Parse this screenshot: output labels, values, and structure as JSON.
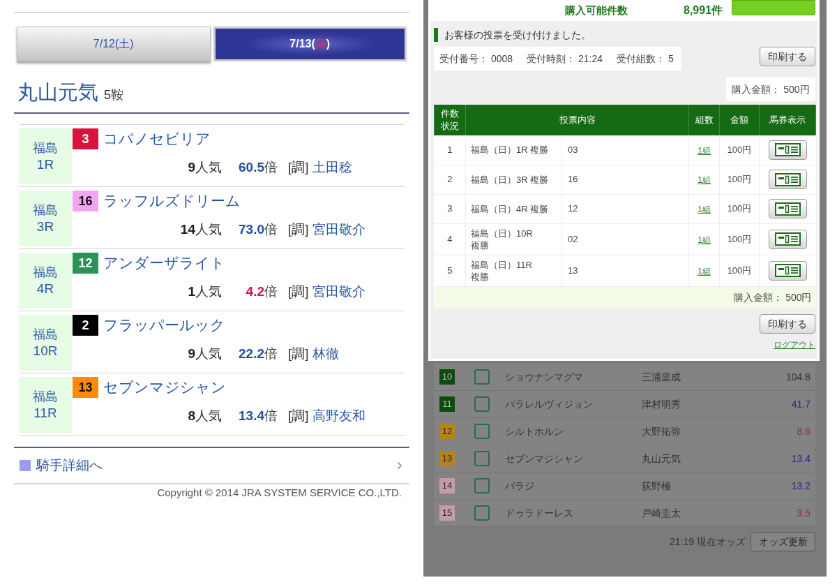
{
  "left_page": {
    "date_tabs": [
      {
        "text_before": "7/12(",
        "weekday": "土",
        "text_after": ")",
        "sunday": false,
        "selected": false
      },
      {
        "text_before": "7/13(",
        "weekday": "日",
        "text_after": ")",
        "sunday": true,
        "selected": true
      }
    ],
    "jockey": {
      "name": "丸山元気",
      "mounts": "5鞍"
    },
    "races": [
      {
        "venue": "福島",
        "race": "1R",
        "horse_number": "3",
        "color": "#d9143c",
        "horse": "コパノセビリア",
        "popularity": "9",
        "popularity_unit": "人気",
        "odds": "60.5",
        "odds_unit": "倍",
        "odds_low": false,
        "trainer_tag": "[調]",
        "trainer": "土田稔"
      },
      {
        "venue": "福島",
        "race": "3R",
        "horse_number": "16",
        "color": "#f3a6f0",
        "horse": "ラッフルズドリーム",
        "popularity": "14",
        "popularity_unit": "人気",
        "odds": "73.0",
        "odds_unit": "倍",
        "odds_low": false,
        "trainer_tag": "[調]",
        "trainer": "宮田敬介"
      },
      {
        "venue": "福島",
        "race": "4R",
        "horse_number": "12",
        "color": "#2e9158",
        "horse": "アンダーザライト",
        "popularity": "1",
        "popularity_unit": "人気",
        "odds": "4.2",
        "odds_unit": "倍",
        "odds_low": true,
        "trainer_tag": "[調]",
        "trainer": "宮田敬介"
      },
      {
        "venue": "福島",
        "race": "10R",
        "horse_number": "2",
        "color": "#000000",
        "horse": "フラッパールック",
        "popularity": "9",
        "popularity_unit": "人気",
        "odds": "22.2",
        "odds_unit": "倍",
        "odds_low": false,
        "trainer_tag": "[調]",
        "trainer": "林徹"
      },
      {
        "venue": "福島",
        "race": "11R",
        "horse_number": "13",
        "color": "#ff8a00",
        "horse": "セブンマジシャン",
        "popularity": "8",
        "popularity_unit": "人気",
        "odds": "13.4",
        "odds_unit": "倍",
        "odds_low": false,
        "trainer_tag": "[調]",
        "trainer": "高野友和"
      }
    ],
    "detail_link": "騎手詳細へ",
    "copyright": "Copyright © 2014 JRA SYSTEM SERVICE CO.,LTD."
  },
  "right_page": {
    "top_bar": {
      "label": "購入可能件数",
      "count": "8,991件"
    },
    "notice": "お客様の投票を受け付けました。",
    "receipt": [
      {
        "label": "受付番号：",
        "value": "0008"
      },
      {
        "label": "受付時刻：",
        "value": "21:24"
      },
      {
        "label": "受付組数：",
        "value": "5"
      }
    ],
    "receipt_print_button": "印刷する",
    "total": {
      "label": "購入金額：",
      "value": "500円"
    },
    "table": {
      "columns": [
        "件数状況",
        "投票内容",
        "組数",
        "金額",
        "馬券表示"
      ],
      "rows": [
        {
          "no": "1",
          "race": "福島（日）1R 複勝",
          "selection": "03",
          "combos": "1組",
          "amount": "100円"
        },
        {
          "no": "2",
          "race": "福島（日）3R 複勝",
          "selection": "16",
          "combos": "1組",
          "amount": "100円"
        },
        {
          "no": "3",
          "race": "福島（日）4R 複勝",
          "selection": "12",
          "combos": "1組",
          "amount": "100円"
        },
        {
          "no": "4",
          "race": "福島（日）10R 複勝",
          "selection": "02",
          "combos": "1組",
          "amount": "100円"
        },
        {
          "no": "5",
          "race": "福島（日）11R 複勝",
          "selection": "13",
          "combos": "1組",
          "amount": "100円"
        }
      ],
      "footer_total": {
        "label": "購入金額：",
        "value": "500円"
      }
    },
    "bottom_print_button": "印刷する",
    "logout": "ログアウト",
    "odds_list": [
      {
        "number": "10",
        "color": "#0c4c0c",
        "checked": false,
        "horse": "ショウナンマグマ",
        "jockey": "三浦皇成",
        "odds": "104.8",
        "odds_low": false,
        "odds_long": true
      },
      {
        "number": "11",
        "color": "#0c4c0c",
        "checked": false,
        "horse": "パラレルヴィジョン",
        "jockey": "津村明秀",
        "odds": "41.7",
        "odds_low": false,
        "odds_long": false
      },
      {
        "number": "12",
        "color": "#b7821c",
        "checked": false,
        "horse": "シルトホルン",
        "jockey": "大野拓弥",
        "odds": "8.6",
        "odds_low": true,
        "odds_long": false
      },
      {
        "number": "13",
        "color": "#b7821c",
        "checked": false,
        "horse": "セブンマジシャン",
        "jockey": "丸山元気",
        "odds": "13.4",
        "odds_low": false,
        "odds_long": false
      },
      {
        "number": "14",
        "color": "#c69ba6",
        "checked": false,
        "horse": "バラジ",
        "jockey": "荻野極",
        "odds": "13.2",
        "odds_low": false,
        "odds_long": false
      },
      {
        "number": "15",
        "color": "#c69ba6",
        "checked": false,
        "horse": "ドゥラドーレス",
        "jockey": "戸崎圭太",
        "odds": "3.5",
        "odds_low": true,
        "odds_long": false
      }
    ],
    "odds_time": "21:19 現在オッズ",
    "odds_refresh_button": "オッズ更新"
  }
}
